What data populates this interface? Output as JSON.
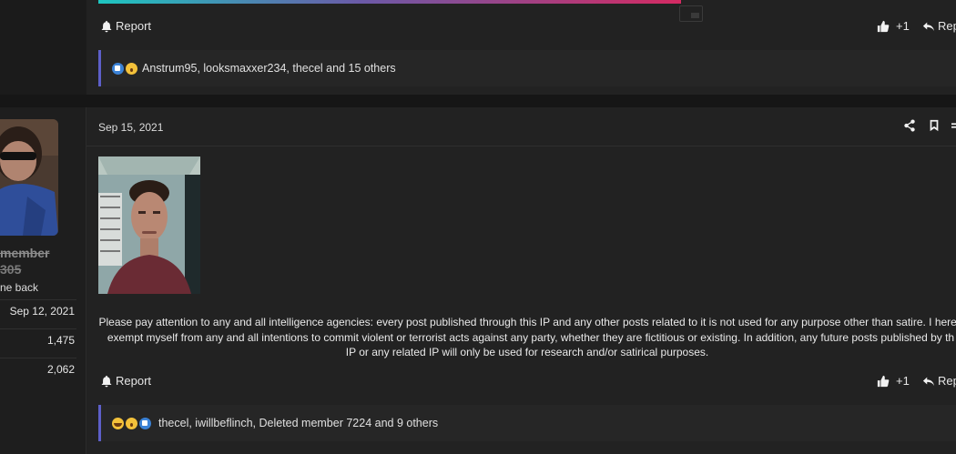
{
  "post_top": {
    "report_label": "Report",
    "like_count": "+1",
    "reply_label": "Rep",
    "reactions": {
      "emojis": [
        "like",
        "wow"
      ],
      "names": "Anstrum95, looksmaxxer234, thecel and 15 others"
    }
  },
  "user": {
    "username": "member",
    "user_id": "305",
    "title": "ne back",
    "stats": {
      "joined": "Sep 12, 2021",
      "posts": "1,475",
      "reputation": "2,062"
    }
  },
  "post": {
    "date": "Sep 15, 2021",
    "body_lines": [
      "Please pay attention to any and all intelligence agencies: every post published through this IP and any other posts related to it is not used for any purpose other than satire. I hereb",
      "exempt myself from any and all intentions to commit violent or terrorist acts against any party, whether they are fictitious or existing. In addition, any future posts published by th",
      "IP or any related IP will only be used for research and/or satirical purposes."
    ],
    "report_label": "Report",
    "like_count": "+1",
    "reply_label": "Rep",
    "reactions": {
      "emojis": [
        "laugh",
        "wow",
        "like"
      ],
      "names": "thecel, iwillbeflinch, Deleted member 7224 and 9 others"
    }
  },
  "icons": {
    "share": "share-icon",
    "bookmark": "bookmark-icon",
    "bell": "bell-icon",
    "thumbs_up": "thumbs-up-icon",
    "reply": "reply-icon"
  },
  "colors": {
    "background": "#1b1b1b",
    "post_bg": "#222222",
    "accent_border": "#5d5fc9",
    "gradient_start": "#1ec6c0",
    "gradient_end": "#d42a62"
  }
}
